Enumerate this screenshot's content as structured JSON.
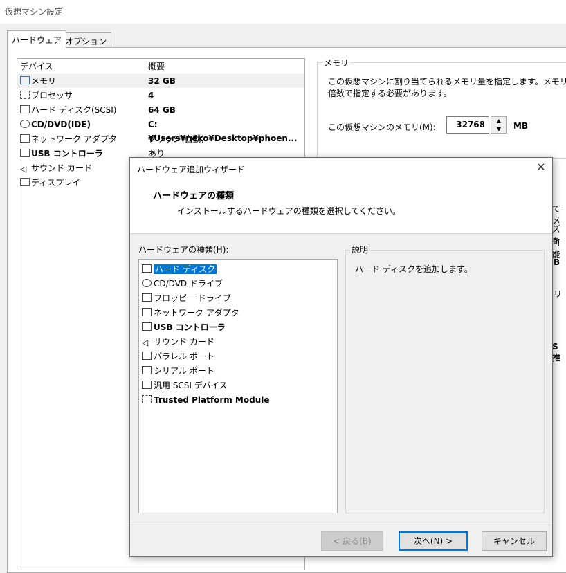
{
  "window": {
    "title": "仮想マシン設定"
  },
  "tabs": [
    {
      "label": "ハードウェア"
    },
    {
      "label": "オプション"
    }
  ],
  "device_list": {
    "headers": {
      "device": "デバイス",
      "summary": "概要"
    },
    "rows": [
      {
        "icon": "memory-icon",
        "name": "メモリ",
        "summary": "32 GB"
      },
      {
        "icon": "processor-icon",
        "name": "プロセッサ",
        "summary": "4"
      },
      {
        "icon": "harddisk-icon",
        "name": "ハード ディスク(SCSI)",
        "summary": "64 GB"
      },
      {
        "icon": "cd-dvd-icon",
        "name": "CD/DVD(IDE)",
        "summary": "C:¥Users¥neko¥Desktop¥phoen..."
      },
      {
        "icon": "network-adapter-icon",
        "name": "ネットワーク アダプタ",
        "summary": "ブリッジ(自動)"
      },
      {
        "icon": "usb-controller-icon",
        "name": "USB コントローラ",
        "summary": "あり"
      },
      {
        "icon": "sound-card-icon",
        "name": "サウンド カード",
        "summary": ""
      },
      {
        "icon": "display-icon",
        "name": "ディスプレイ",
        "summary": ""
      }
    ]
  },
  "memory_panel": {
    "group_title": "メモリ",
    "description": "この仮想マシンに割り当てられるメモリ量を指定します。メモリ\n倍数で指定する必要があります。",
    "field_label": "この仮想マシンのメモリ(M):",
    "value": "32768",
    "unit": "MB",
    "edge_fragments": [
      "てメ",
      "ズを",
      "可能",
      "B",
      "リ",
      "S 推"
    ]
  },
  "dialog": {
    "title": "ハードウェア追加ウィザード",
    "close_glyph": "✕",
    "heading": "ハードウェアの種類",
    "subheading": "インストールするハードウェアの種類を選択してください。",
    "hw_type_label": "ハードウェアの種類(H):",
    "hw_types": [
      {
        "icon": "harddisk-icon",
        "label": "ハード ディスク"
      },
      {
        "icon": "cd-dvd-icon",
        "label": "CD/DVD ドライブ"
      },
      {
        "icon": "floppy-icon",
        "label": "フロッピー ドライブ"
      },
      {
        "icon": "network-adapter-icon",
        "label": "ネットワーク アダプタ"
      },
      {
        "icon": "usb-controller-icon",
        "label": "USB コントローラ"
      },
      {
        "icon": "sound-card-icon",
        "label": "サウンド カード"
      },
      {
        "icon": "parallel-port-icon",
        "label": "パラレル ポート"
      },
      {
        "icon": "serial-port-icon",
        "label": "シリアル ポート"
      },
      {
        "icon": "generic-scsi-icon",
        "label": "汎用 SCSI デバイス"
      },
      {
        "icon": "tpm-icon",
        "label": "Trusted Platform Module"
      }
    ],
    "selected_hw_type": "ハード ディスク",
    "description_title": "説明",
    "description_text": "ハード ディスクを追加します。",
    "buttons": {
      "back": "< 戻る(B)",
      "next": "次へ(N) >",
      "cancel": "キャンセル"
    }
  },
  "colors": {
    "selection": "#0078d7",
    "dialog_bg": "#f0f0f0",
    "panel_bg": "#ffffff"
  }
}
